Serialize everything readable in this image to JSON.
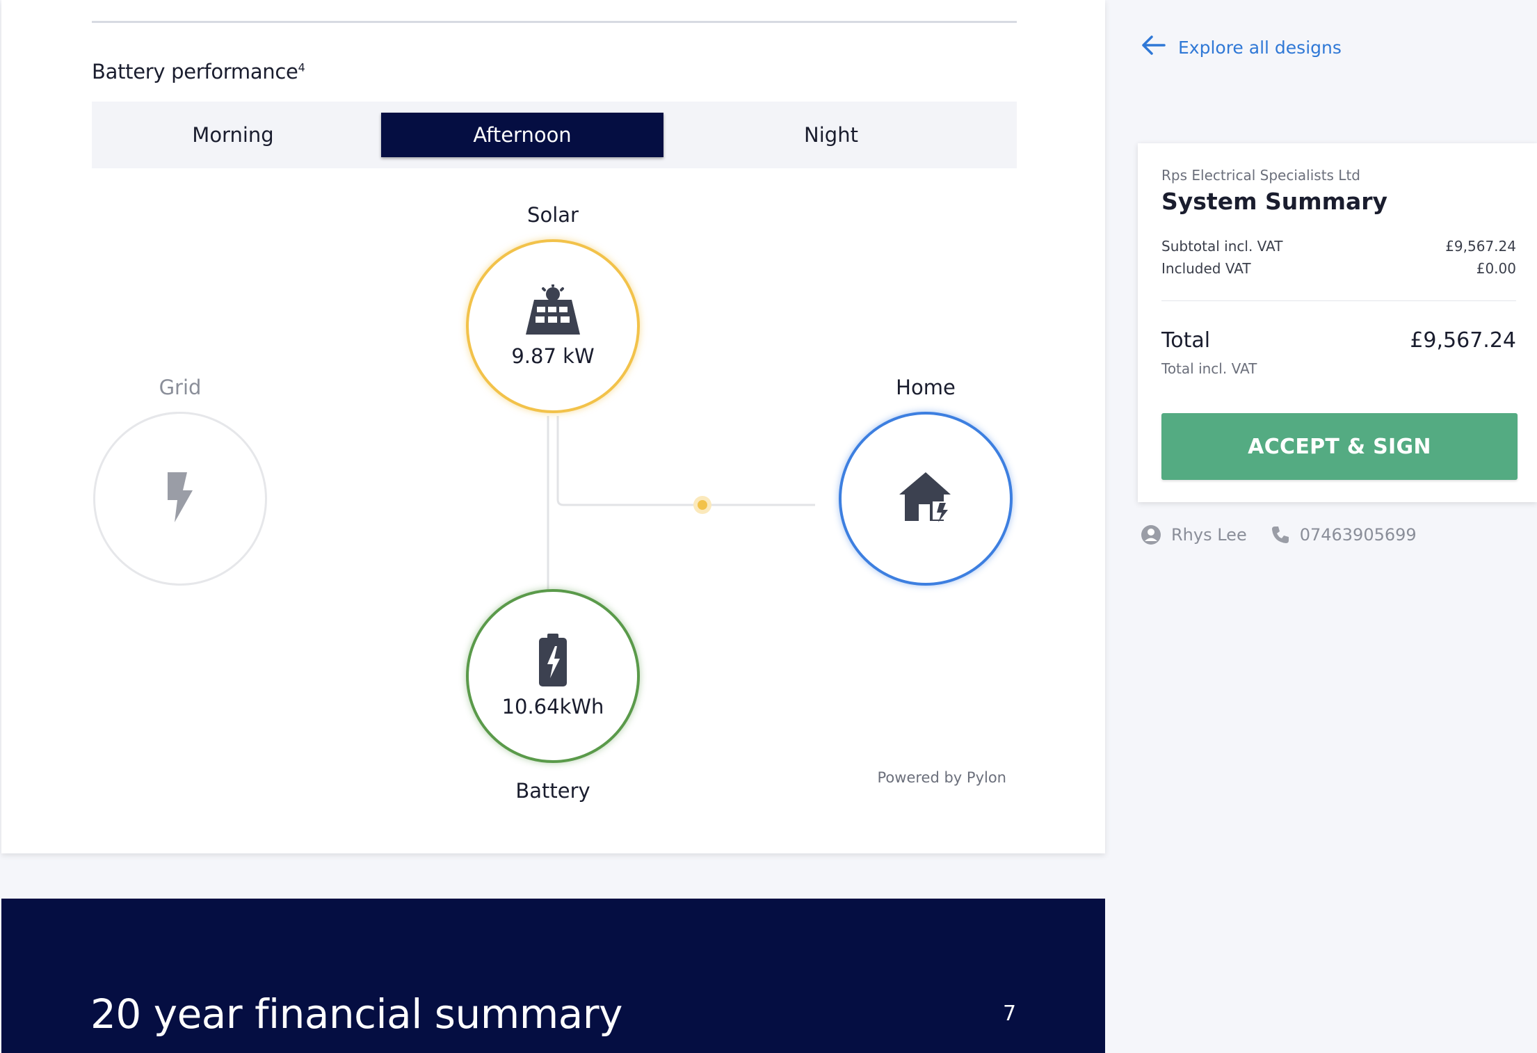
{
  "battery_section": {
    "title": "Battery performance",
    "title_sup": "4",
    "tabs": [
      {
        "label": "Morning",
        "active": false
      },
      {
        "label": "Afternoon",
        "active": true
      },
      {
        "label": "Night",
        "active": false
      }
    ],
    "nodes": {
      "solar": {
        "label": "Solar",
        "value": "9.87 kW",
        "icon": "solar-panel-icon",
        "color": "#f2c24a"
      },
      "grid": {
        "label": "Grid",
        "icon": "lightning-bolt-icon",
        "color": "#e6e7ea"
      },
      "home": {
        "label": "Home",
        "icon": "house-icon",
        "color": "#3d7fe0"
      },
      "battery": {
        "label": "Battery",
        "value": "10.64kWh",
        "icon": "battery-icon",
        "color": "#5a9a4a"
      }
    },
    "powered_by": "Powered by Pylon"
  },
  "financial": {
    "title": "20 year financial summary",
    "number": "7"
  },
  "sidebar": {
    "explore_label": "Explore all designs",
    "company": "Rps Electrical Specialists Ltd",
    "summary_title": "System Summary",
    "subtotal_label": "Subtotal incl. VAT",
    "subtotal_value": "£9,567.24",
    "vat_label": "Included VAT",
    "vat_value": "£0.00",
    "total_label": "Total",
    "total_value": "£9,567.24",
    "total_sub": "Total incl. VAT",
    "accept_label": "ACCEPT & SIGN",
    "contact_name": "Rhys Lee",
    "contact_phone": "07463905699"
  },
  "colors": {
    "navy": "#050e42",
    "accept_green": "#54ab82",
    "link_blue": "#2f78d6"
  }
}
